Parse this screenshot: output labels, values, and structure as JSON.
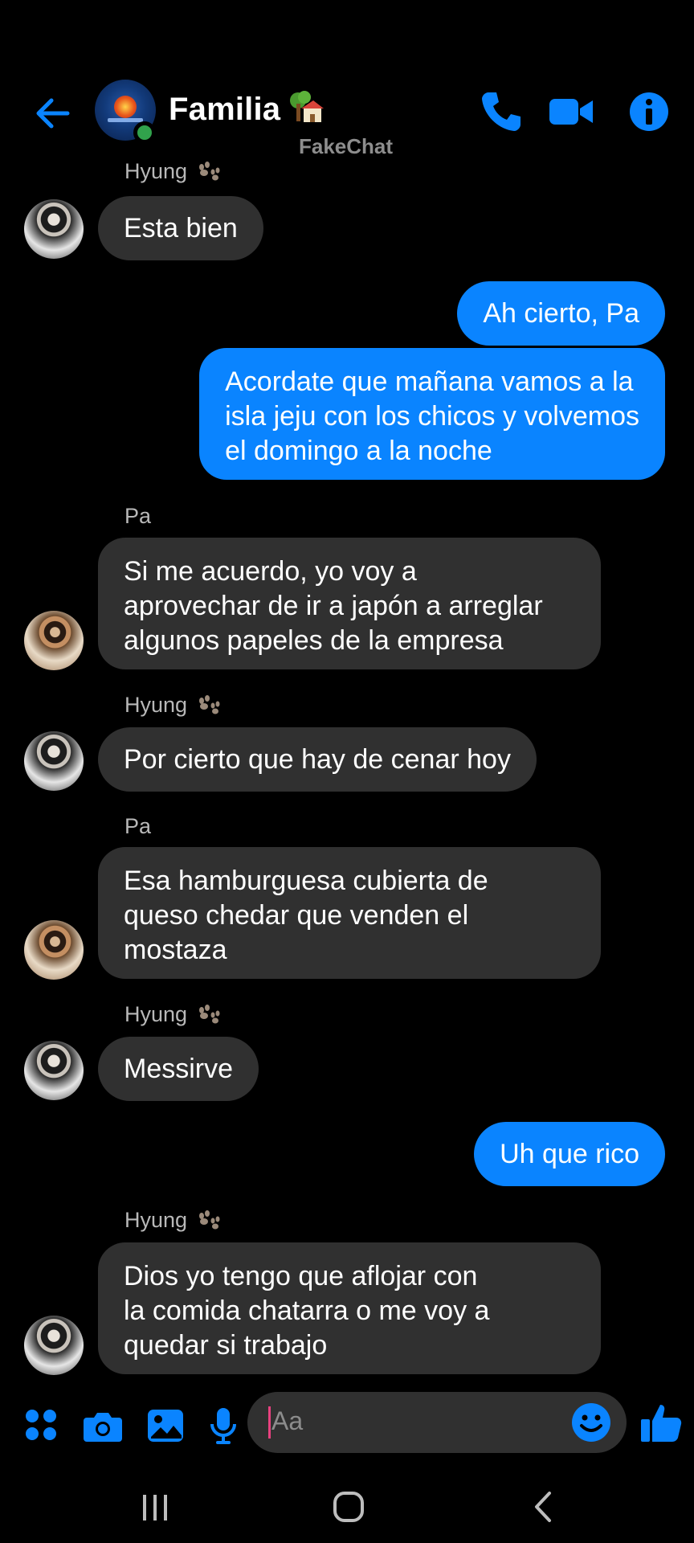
{
  "header": {
    "title": "Familia",
    "title_emoji": "tree-house-emoji",
    "watermark": "FakeChat",
    "icons": [
      "back-arrow-icon",
      "phone-icon",
      "video-camera-icon",
      "info-icon"
    ],
    "accent_color": "#0a84ff",
    "online_color": "#31a24c"
  },
  "messages": [
    {
      "sender": "Hyung",
      "sender_emoji": "paw-prints",
      "direction": "in",
      "avatar": "hyung",
      "lines": [
        "Esta bien"
      ]
    },
    {
      "direction": "out",
      "lines": [
        "Ah cierto, Pa"
      ]
    },
    {
      "direction": "out",
      "lines": [
        "Acordate que mañana vamos a la",
        "isla jeju con los chicos y volvemos",
        "el domingo a la noche"
      ]
    },
    {
      "sender": "Pa",
      "direction": "in",
      "avatar": "pa",
      "lines": [
        "Si me acuerdo, yo voy a",
        "aprovechar de ir a japón a arreglar",
        "algunos papeles de la empresa"
      ]
    },
    {
      "sender": "Hyung",
      "sender_emoji": "paw-prints",
      "direction": "in",
      "avatar": "hyung",
      "lines": [
        "Por cierto que hay de cenar hoy"
      ]
    },
    {
      "sender": "Pa",
      "direction": "in",
      "avatar": "pa",
      "lines": [
        "Esa hamburguesa cubierta de",
        "queso chedar que venden el",
        "mostaza"
      ]
    },
    {
      "sender": "Hyung",
      "sender_emoji": "paw-prints",
      "direction": "in",
      "avatar": "hyung",
      "lines": [
        "Messirve"
      ]
    },
    {
      "direction": "out",
      "lines": [
        "Uh que rico"
      ]
    },
    {
      "sender": "Hyung",
      "sender_emoji": "paw-prints",
      "direction": "in",
      "avatar": "hyung",
      "lines": [
        "Dios yo tengo que aflojar con",
        "la comida chatarra o me voy a",
        "quedar si trabajo"
      ]
    }
  ],
  "composer": {
    "placeholder": "Aa",
    "icons": [
      "apps-icon",
      "camera-icon",
      "image-icon",
      "microphone-icon",
      "emoji-icon",
      "thumbs-up-icon"
    ]
  },
  "navbar": {
    "icons": [
      "recent-apps-icon",
      "home-icon",
      "back-icon"
    ]
  },
  "colors": {
    "background": "#000000",
    "incoming_bubble": "#303030",
    "outgoing_bubble": "#0a84ff",
    "sender_label": "#b8b8b8"
  }
}
